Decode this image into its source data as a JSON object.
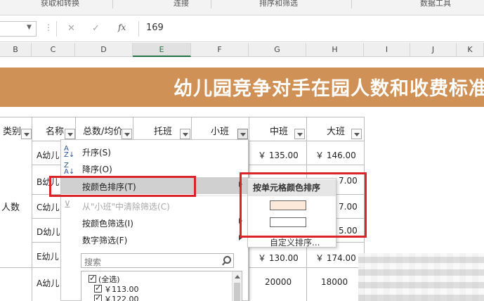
{
  "ribbon": {
    "groups": [
      "获取和转换",
      "连接",
      "排序和筛选",
      "数据工具"
    ]
  },
  "formula_bar": {
    "value": "169",
    "fx_label": "fx",
    "cancel_icon": "close-icon",
    "enter_icon": "check-icon"
  },
  "columns": [
    "B",
    "C",
    "D",
    "E",
    "F",
    "G",
    "H",
    "I",
    "J",
    "K"
  ],
  "selected_column": "E",
  "title": "幼儿园竞争对手在园人数和收费标准",
  "table": {
    "headers": [
      "类别",
      "名称",
      "总数/均价",
      "托班",
      "小班",
      "中班",
      "大班"
    ],
    "category": "人数",
    "names": [
      "A幼儿",
      "B幼儿",
      "C幼儿",
      "D幼儿",
      "E幼儿",
      "A幼儿"
    ],
    "g_col": [
      "￥ 135.00",
      "",
      "",
      "",
      "￥ 130.00",
      "20000"
    ],
    "h_col": [
      "￥ 146.00",
      "7.00",
      "7.00",
      "5.00",
      "￥ 174.00",
      "18000"
    ]
  },
  "menu": {
    "sort_asc": "升序(S)",
    "sort_desc": "降序(O)",
    "sort_by_color": "按颜色排序(T)",
    "clear_filter": "从\"小班\"中清除筛选(C)",
    "filter_by_color": "按颜色筛选(I)",
    "number_filter": "数字筛选(F)",
    "search_placeholder": "搜索",
    "list_items": [
      "(全选)",
      "￥113.00",
      "￥122.00"
    ]
  },
  "submenu": {
    "header": "按单元格颜色排序",
    "swatches": [
      "#fde9d9",
      "#ffffff"
    ],
    "custom": "自定义排序..."
  },
  "colors": {
    "title_band": "#cf9155",
    "highlight_box": "#d9252a",
    "menu_highlight": "#d0d0d0"
  }
}
